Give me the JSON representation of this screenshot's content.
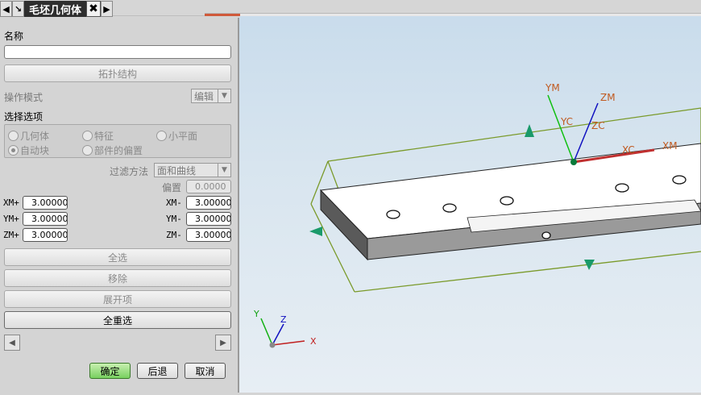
{
  "window": {
    "title": "毛坯几何体"
  },
  "form": {
    "name_label": "名称",
    "name_value": "",
    "topology_button": "拓扑结构",
    "op_mode_label": "操作模式",
    "op_mode_value": "编辑",
    "select_options_label": "选择选项",
    "radios": {
      "geometry": "几何体",
      "feature": "特征",
      "facet": "小平面",
      "auto_block": "自动块",
      "part_offset": "部件的偏置"
    },
    "filter_label": "过滤方法",
    "filter_value": "面和曲线",
    "offset_label": "偏置",
    "offset_value": "0.0000",
    "offsets": {
      "xm_plus_label": "XM+",
      "xm_plus": "3.00000",
      "ym_plus_label": "YM+",
      "ym_plus": "3.00000",
      "zm_plus_label": "ZM+",
      "zm_plus": "3.00000",
      "xm_minus_label": "XM-",
      "xm_minus": "3.00000",
      "ym_minus_label": "YM-",
      "ym_minus": "3.00000",
      "zm_minus_label": "ZM-",
      "zm_minus": "3.00000"
    },
    "select_all": "全选",
    "remove": "移除",
    "expand": "展开项",
    "reselect_all": "全重选",
    "ok": "确定",
    "back": "后退",
    "cancel": "取消"
  },
  "viewport": {
    "axes": {
      "ym": "YM",
      "zm": "ZM",
      "yc": "YC",
      "zc": "ZC",
      "xc": "XC",
      "xm": "XM"
    },
    "triad": {
      "x": "X",
      "y": "Y",
      "z": "Z"
    }
  },
  "colors": {
    "accent_green": "#2a8a2a",
    "axis_blue": "#1010c0",
    "axis_red": "#c03030",
    "box": "#7a9a2a"
  }
}
